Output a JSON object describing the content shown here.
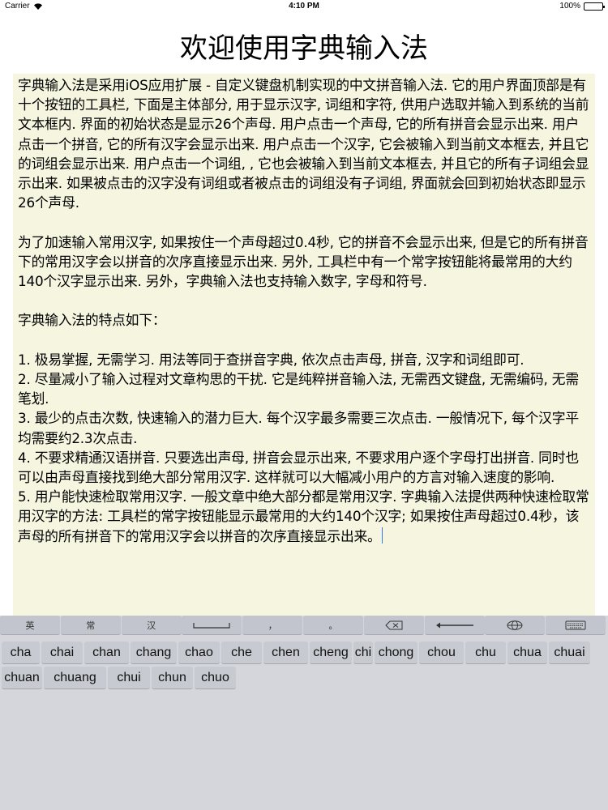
{
  "status": {
    "carrier": "Carrier",
    "time": "4:10 PM",
    "battery": "100%",
    "battery_level": 1.0
  },
  "title": "欢迎使用字典输入法",
  "text": {
    "p1": "字典输入法是采用iOS应用扩展 - 自定义键盘机制实现的中文拼音输入法. 它的用户界面顶部是有十个按钮的工具栏, 下面是主体部分, 用于显示汉字, 词组和字符, 供用户选取并输入到系统的当前文本框内. 界面的初始状态是显示26个声母. 用户点击一个声母, 它的所有拼音会显示出来. 用户点击一个拼音, 它的所有汉字会显示出来. 用户点击一个汉字, 它会被输入到当前文本框去, 并且它的词组会显示出来. 用户点击一个词组, , 它也会被输入到当前文本框去, 并且它的所有子词组会显示出来. 如果被点击的汉字没有词组或者被点击的词组没有子词组, 界面就会回到初始状态即显示26个声母.",
    "p2": "为了加速输入常用汉字, 如果按住一个声母超过0.4秒, 它的拼音不会显示出来, 但是它的所有拼音下的常用汉字会以拼音的次序直接显示出来. 另外, 工具栏中有一个常字按钮能将最常用的大约140个汉字显示出来. 另外，字典输入法也支持输入数字, 字母和符号.",
    "p3": "字典输入法的特点如下：",
    "items": [
      "1. 极易掌握, 无需学习. 用法等同于查拼音字典, 依次点击声母, 拼音, 汉字和词组即可.",
      "2. 尽量减小了输入过程对文章构思的干扰. 它是纯粹拼音输入法, 无需西文键盘, 无需编码, 无需笔划.",
      "3. 最少的点击次数, 快速输入的潜力巨大. 每个汉字最多需要三次点击. 一般情况下, 每个汉字平均需要约2.3次点击.",
      "4. 不要求精通汉语拼音. 只要选出声母, 拼音会显示出来, 不要求用户逐个字母打出拼音. 同时也可以由声母直接找到绝大部分常用汉字.  这样就可以大幅减小用户的方言对输入速度的影响.",
      "5. 用户能快速检取常用汉字. 一般文章中绝大部分都是常用汉字. 字典输入法提供两种快速检取常用汉字的方法: 工具栏的常字按钮能显示最常用的大约140个汉字; 如果按住声母超过0.4秒，该声母的所有拼音下的常用汉字会以拼音的次序直接显示出来。"
    ]
  },
  "toolbar": {
    "en_label": "英",
    "common_label": "常",
    "han_label": "汉",
    "comma_label": "，",
    "period_label": "。"
  },
  "candidates": [
    "cha",
    "chai",
    "chan",
    "chang",
    "chao",
    "che",
    "chen",
    "cheng",
    "chi",
    "chong",
    "chou",
    "chu",
    "chua",
    "chuai",
    "chuan",
    "chuang",
    "chui",
    "chun",
    "chuo"
  ]
}
